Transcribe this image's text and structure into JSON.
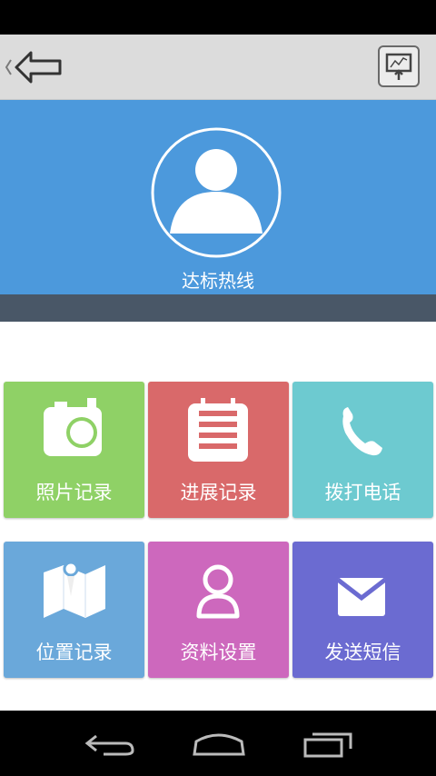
{
  "colors": {
    "header_bg": "#dcdcdc",
    "hero_bg": "#4c99dc",
    "hero_bottom_bar": "#495767",
    "tile_green": "#8fd166",
    "tile_red": "#d9696a",
    "tile_teal": "#6dcad0",
    "tile_blue": "#6aa8da",
    "tile_pink": "#cd68bd",
    "tile_purple": "#6b6bd1"
  },
  "header": {
    "back_icon": "back-arrow-icon",
    "action_icon": "chart-presentation-icon"
  },
  "hero": {
    "avatar_icon": "user-avatar-icon",
    "title": "达标热线"
  },
  "tiles": [
    {
      "label": "照片记录",
      "icon": "camera-icon"
    },
    {
      "label": "进展记录",
      "icon": "calendar-icon"
    },
    {
      "label": "拨打电话",
      "icon": "phone-icon"
    },
    {
      "label": "位置记录",
      "icon": "map-icon"
    },
    {
      "label": "资料设置",
      "icon": "person-icon"
    },
    {
      "label": "发送短信",
      "icon": "envelope-icon"
    }
  ],
  "navbar": {
    "back": "nav-back-icon",
    "home": "nav-home-icon",
    "recents": "nav-recents-icon"
  }
}
